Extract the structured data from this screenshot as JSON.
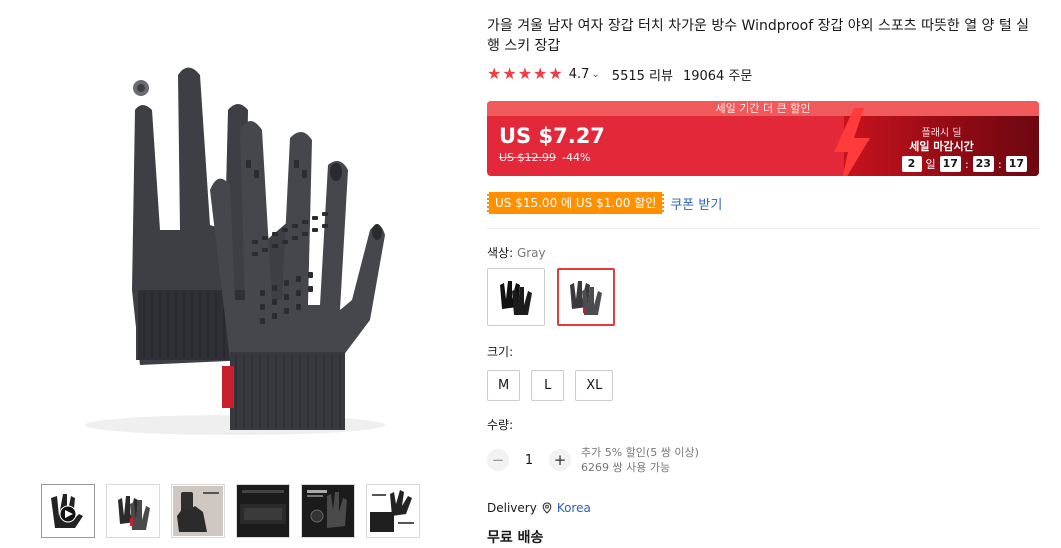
{
  "product": {
    "title": "가을 겨울 남자 여자 장갑 터치 차가운 방수 Windproof 장갑 야외 스포츠 따뜻한 열 양 털 실행 스키 장갑",
    "rating": "4.7",
    "rating_stars": 5,
    "reviews": "5515 리뷰",
    "orders": "19064 주문"
  },
  "price": {
    "banner_top": "세일 기간 더 큰 할인",
    "current": "US $7.27",
    "original": "US $12.99",
    "discount": "-44%",
    "flash_label": "플래시 딜",
    "flash_title": "세일 마감시간",
    "countdown": {
      "days": "2",
      "day_unit": "일",
      "hours": "17",
      "minutes": "23",
      "seconds": "17",
      "sep": ":"
    }
  },
  "coupon": {
    "tag": "US $15.00 에 US $1.00 할인",
    "link": "쿠폰 받기"
  },
  "color": {
    "label": "색상:",
    "selected": "Gray",
    "options": [
      "Black",
      "Gray"
    ]
  },
  "size": {
    "label": "크기:",
    "options": [
      "M",
      "L",
      "XL"
    ]
  },
  "quantity": {
    "label": "수량:",
    "minus": "−",
    "value": "1",
    "plus": "+",
    "bulk_discount": "추가 5% 할인(5 쌍 이상)",
    "available": "6269 쌍 사용 가능"
  },
  "delivery": {
    "label": "Delivery",
    "country": "Korea",
    "shipping": "무료 배송"
  },
  "colors": {
    "accent_red": "#e3283a",
    "star_red": "#f23d45",
    "coupon_orange": "#ff9000",
    "link_blue": "#2e63b8"
  }
}
